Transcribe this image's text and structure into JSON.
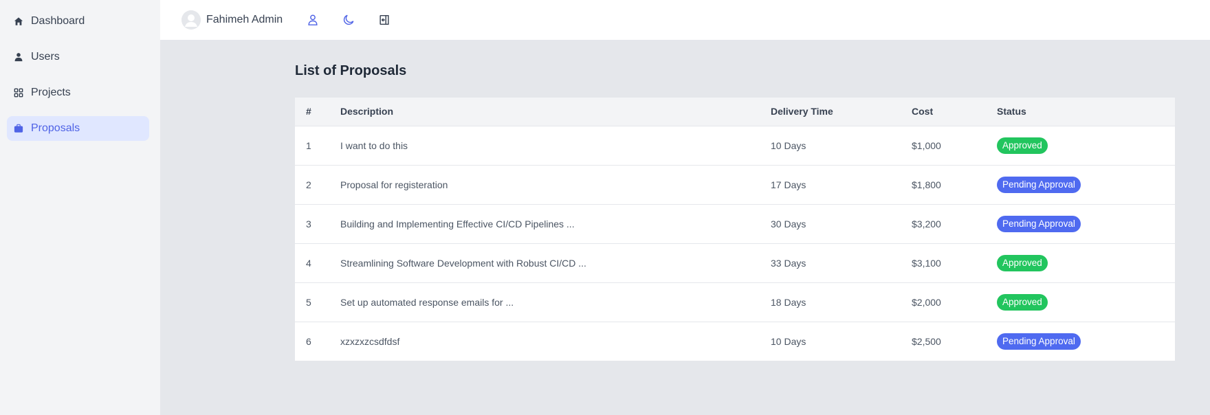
{
  "sidebar": {
    "items": [
      {
        "label": "Dashboard",
        "icon": "home-icon",
        "active": false
      },
      {
        "label": "Users",
        "icon": "user-icon",
        "active": false
      },
      {
        "label": "Projects",
        "icon": "grid-icon",
        "active": false
      },
      {
        "label": "Proposals",
        "icon": "briefcase-icon",
        "active": true
      }
    ]
  },
  "topbar": {
    "username": "Fahimeh Admin",
    "icons": [
      "profile-icon",
      "moon-icon",
      "logout-icon"
    ]
  },
  "page": {
    "title": "List of Proposals"
  },
  "table": {
    "headers": [
      "#",
      "Description",
      "Delivery Time",
      "Cost",
      "Status"
    ],
    "rows": [
      {
        "num": "1",
        "description": "I want to do this",
        "delivery": "10 Days",
        "cost": "$1,000",
        "status": "Approved",
        "status_type": "approved"
      },
      {
        "num": "2",
        "description": "Proposal for registeration",
        "delivery": "17 Days",
        "cost": "$1,800",
        "status": "Pending Approval",
        "status_type": "pending"
      },
      {
        "num": "3",
        "description": "Building and Implementing Effective CI/CD Pipelines ...",
        "delivery": "30 Days",
        "cost": "$3,200",
        "status": "Pending Approval",
        "status_type": "pending"
      },
      {
        "num": "4",
        "description": "Streamlining Software Development with Robust CI/CD ...",
        "delivery": "33 Days",
        "cost": "$3,100",
        "status": "Approved",
        "status_type": "approved"
      },
      {
        "num": "5",
        "description": "Set up automated response emails for ...",
        "delivery": "18 Days",
        "cost": "$2,000",
        "status": "Approved",
        "status_type": "approved"
      },
      {
        "num": "6",
        "description": "xzxzxzcsdfdsf",
        "delivery": "10 Days",
        "cost": "$2,500",
        "status": "Pending Approval",
        "status_type": "pending"
      }
    ]
  },
  "colors": {
    "accent": "#4f63e6",
    "approved": "#22c55e",
    "pending": "#4f6af0"
  }
}
